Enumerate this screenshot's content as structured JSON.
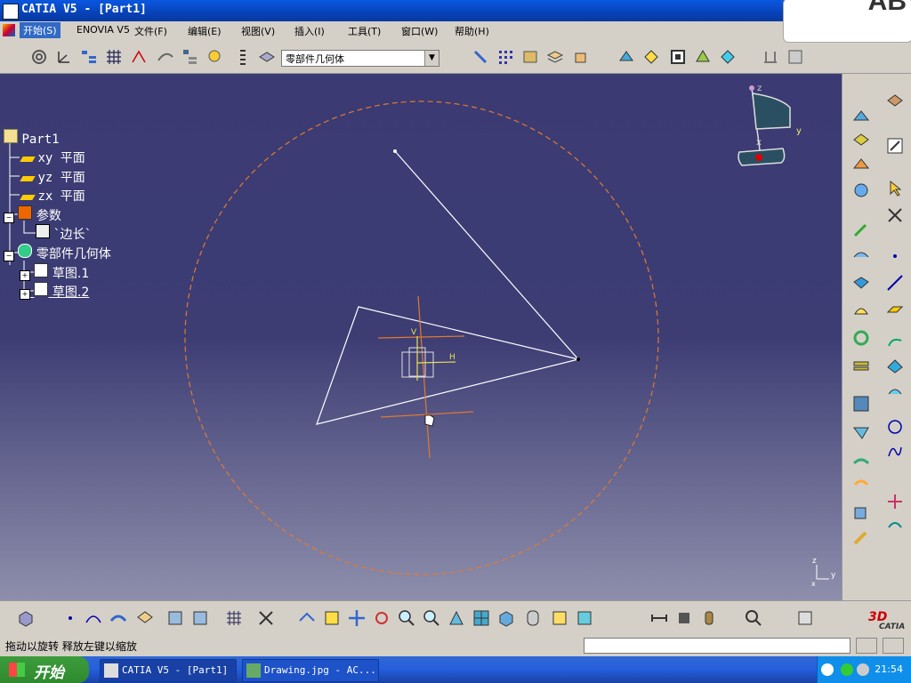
{
  "window": {
    "title": "CATIA V5 - [Part1]"
  },
  "watermark": "AB",
  "menu": {
    "start": "开始(S)",
    "items": [
      "ENOVIA V5",
      "文件(F)",
      "编辑(E)",
      "视图(V)",
      "插入(I)",
      "工具(T)",
      "窗口(W)",
      "帮助(H)"
    ]
  },
  "toolbar": {
    "body_combo_value": "零部件几何体"
  },
  "tree": {
    "root": "Part1",
    "xy": "xy 平面",
    "yz": "yz 平面",
    "zx": "zx 平面",
    "params": "参数",
    "param_edge": "`边长`",
    "body": "零部件几何体",
    "sketch1": "草图.1",
    "sketch2": "草图.2"
  },
  "viewport": {
    "axis_labels": {
      "h": "H",
      "v": "V"
    },
    "compass": {
      "z": "z",
      "y": "y",
      "x": "x"
    },
    "small_axis": {
      "z": "z",
      "y": "y",
      "x": "x"
    }
  },
  "status": {
    "hint": "拖动以旋转   释放左键以缩放"
  },
  "taskbar": {
    "start": "开始",
    "tasks": [
      "CATIA V5 - [Part1]",
      "Drawing.jpg - AC..."
    ],
    "clock": "21:54"
  },
  "brand": "CATIA",
  "colors": {
    "accent": "#0a58e0",
    "viewport_top": "#3b3a73",
    "construction": "#e07a30",
    "sketch_line": "#ffffff"
  }
}
